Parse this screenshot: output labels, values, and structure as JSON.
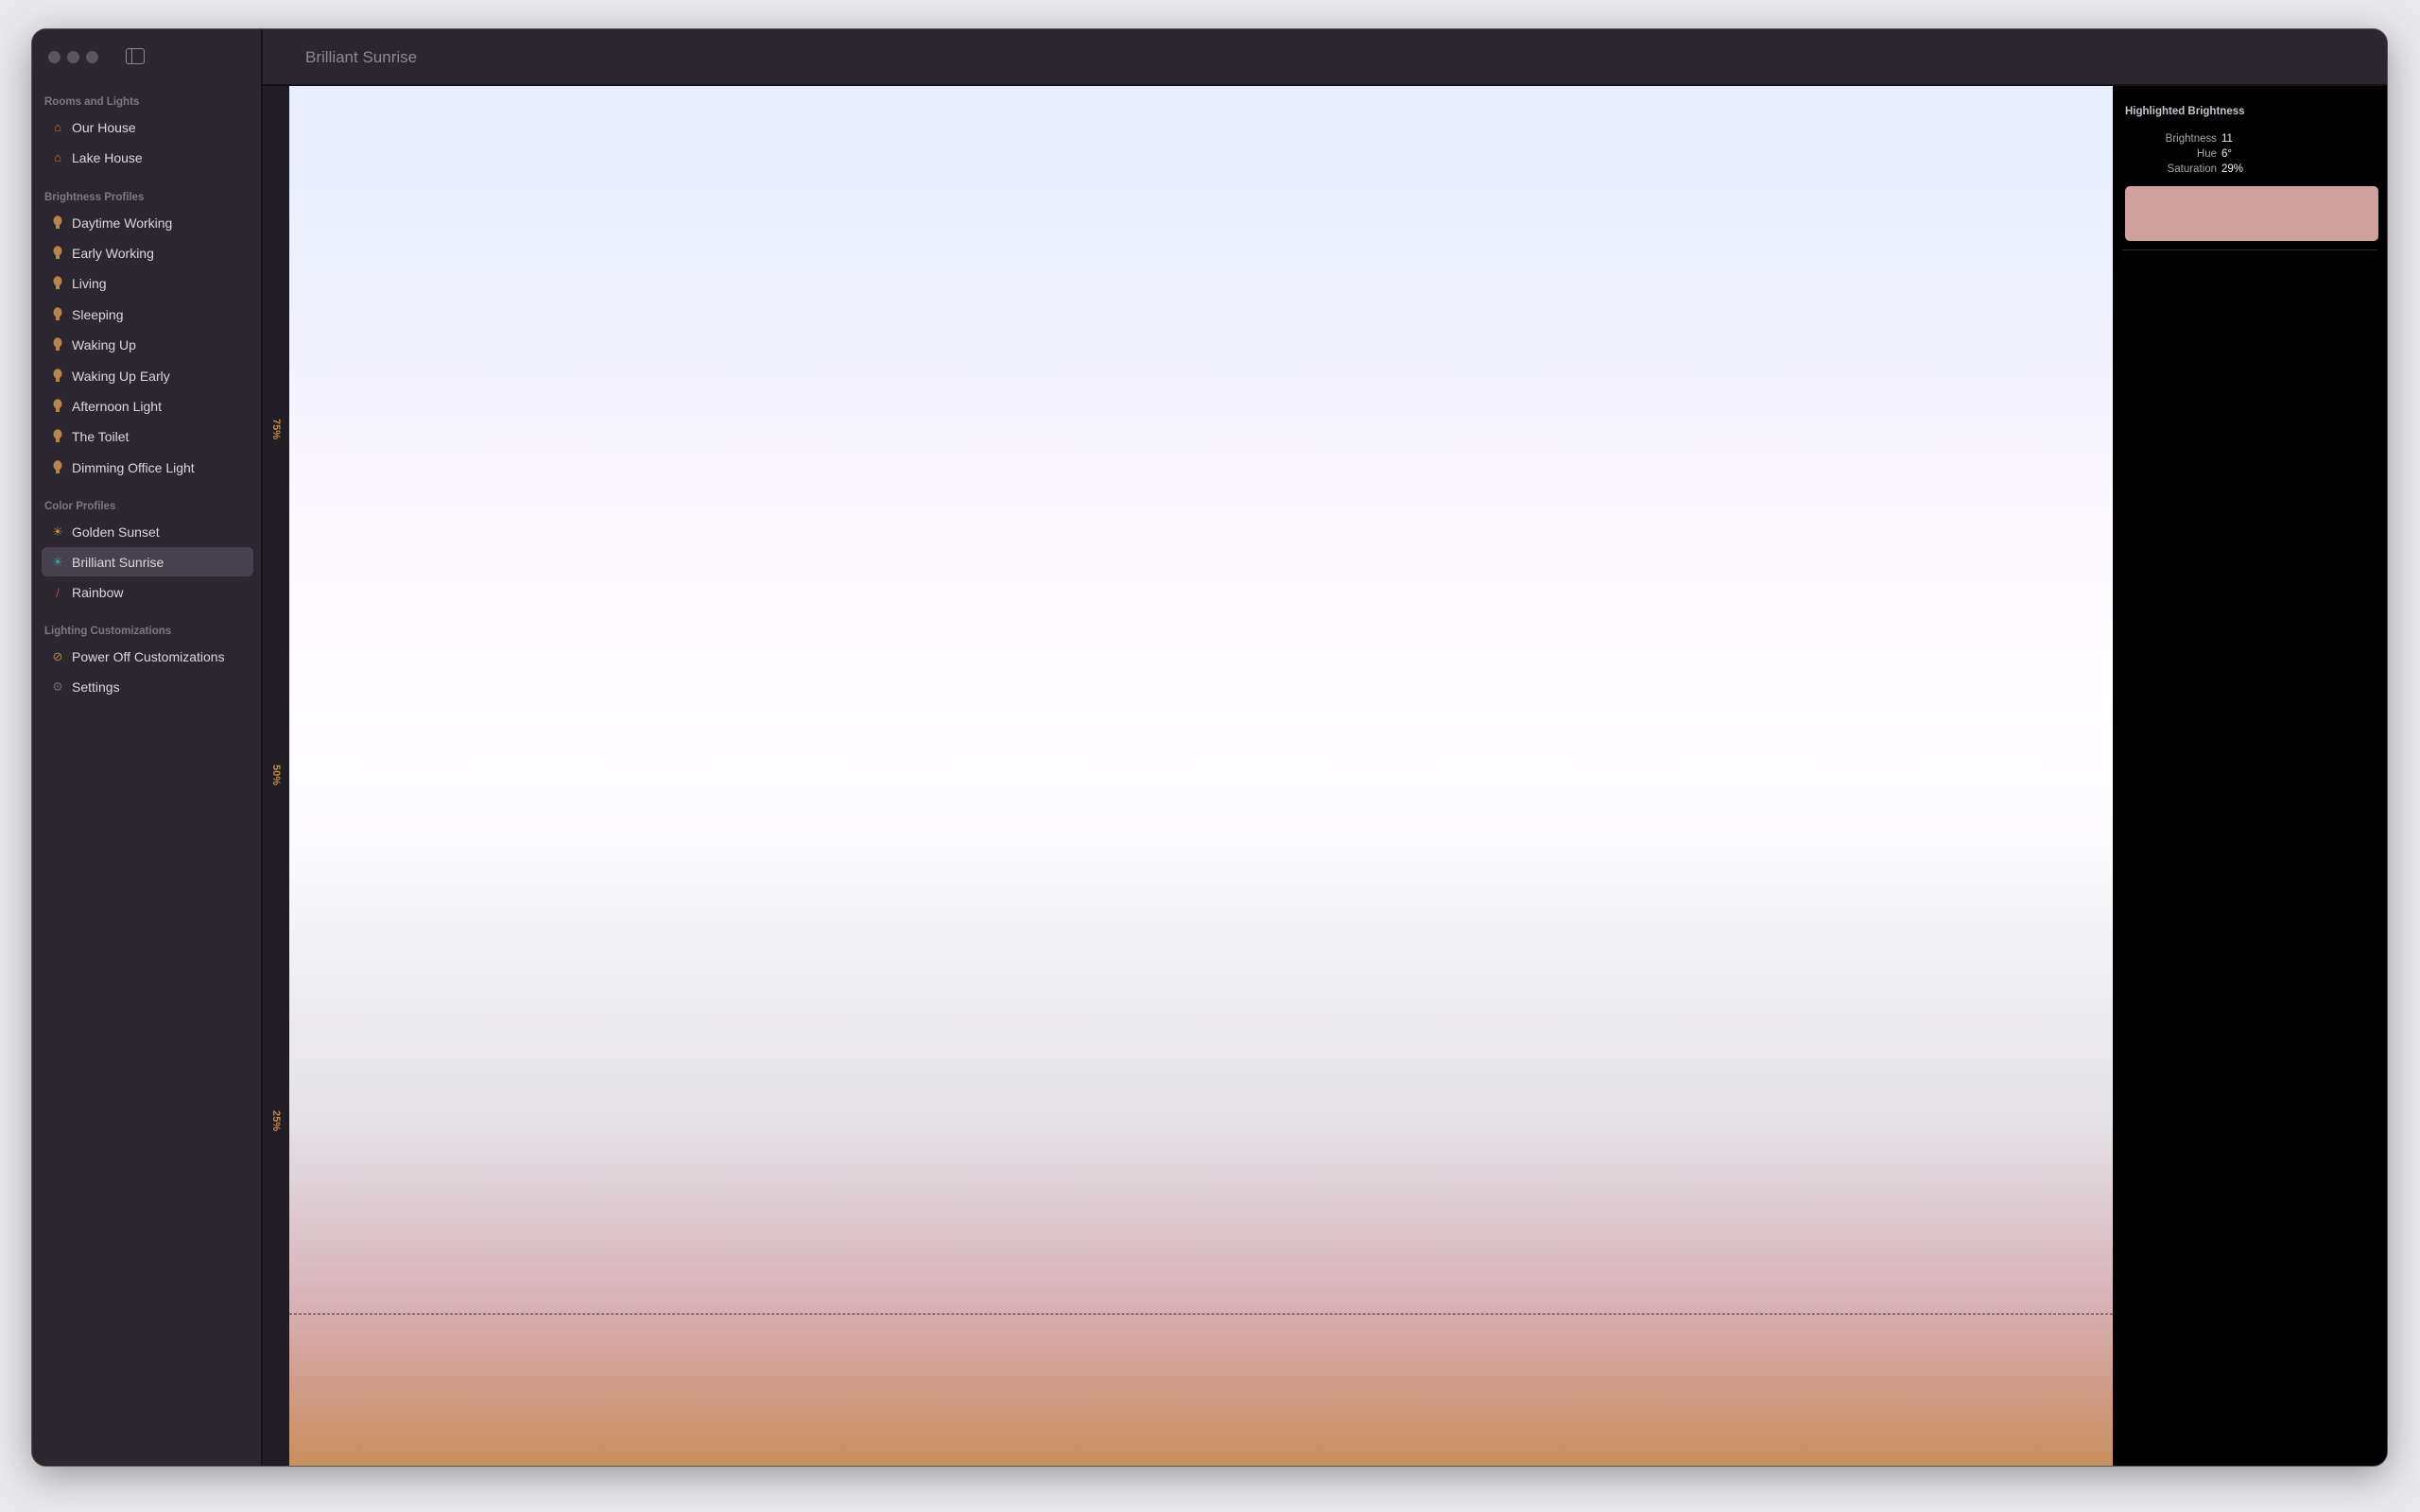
{
  "window": {
    "title": "Brilliant Sunrise"
  },
  "sidebar": {
    "sections": [
      {
        "label": "Rooms and Lights",
        "items": [
          {
            "label": "Our House",
            "icon": "house-icon"
          },
          {
            "label": "Lake House",
            "icon": "house-icon"
          }
        ]
      },
      {
        "label": "Brightness Profiles",
        "items": [
          {
            "label": "Daytime Working",
            "icon": "lightbulb-icon"
          },
          {
            "label": "Early Working",
            "icon": "lightbulb-icon"
          },
          {
            "label": "Living",
            "icon": "lightbulb-icon"
          },
          {
            "label": "Sleeping",
            "icon": "lightbulb-icon"
          },
          {
            "label": "Waking Up",
            "icon": "lightbulb-icon"
          },
          {
            "label": "Waking Up Early",
            "icon": "lightbulb-icon"
          },
          {
            "label": "Afternoon Light",
            "icon": "lightbulb-icon"
          },
          {
            "label": "The Toilet",
            "icon": "lightbulb-icon"
          },
          {
            "label": "Dimming Office Light",
            "icon": "lightbulb-icon"
          }
        ]
      },
      {
        "label": "Color Profiles",
        "items": [
          {
            "label": "Golden Sunset",
            "icon": "sunset-icon"
          },
          {
            "label": "Brilliant Sunrise",
            "icon": "sunrise-icon",
            "selected": true
          },
          {
            "label": "Rainbow",
            "icon": "eyedropper-icon"
          }
        ]
      },
      {
        "label": "Lighting Customizations",
        "items": [
          {
            "label": "Power Off Customizations",
            "icon": "lightbulb-slash-icon"
          },
          {
            "label": "Settings",
            "icon": "gear-icon"
          }
        ]
      }
    ]
  },
  "axis": {
    "labels": [
      "75%",
      "50%",
      "25%"
    ]
  },
  "gradient": {
    "colors": [
      "#e7eefe",
      "#fbf7fe",
      "#fffdff",
      "#e4e2e6",
      "#d8b2b8",
      "#c98f5d"
    ],
    "highlighted_brightness": 11
  },
  "panel": {
    "heading": "Highlighted Brightness",
    "rows": [
      {
        "key": "Brightness",
        "value": "11"
      },
      {
        "key": "Hue",
        "value": "6°"
      },
      {
        "key": "Saturation",
        "value": "29%"
      }
    ],
    "swatch_color": "#cfa19d"
  },
  "colors": {
    "accent": "#c98a3a"
  }
}
